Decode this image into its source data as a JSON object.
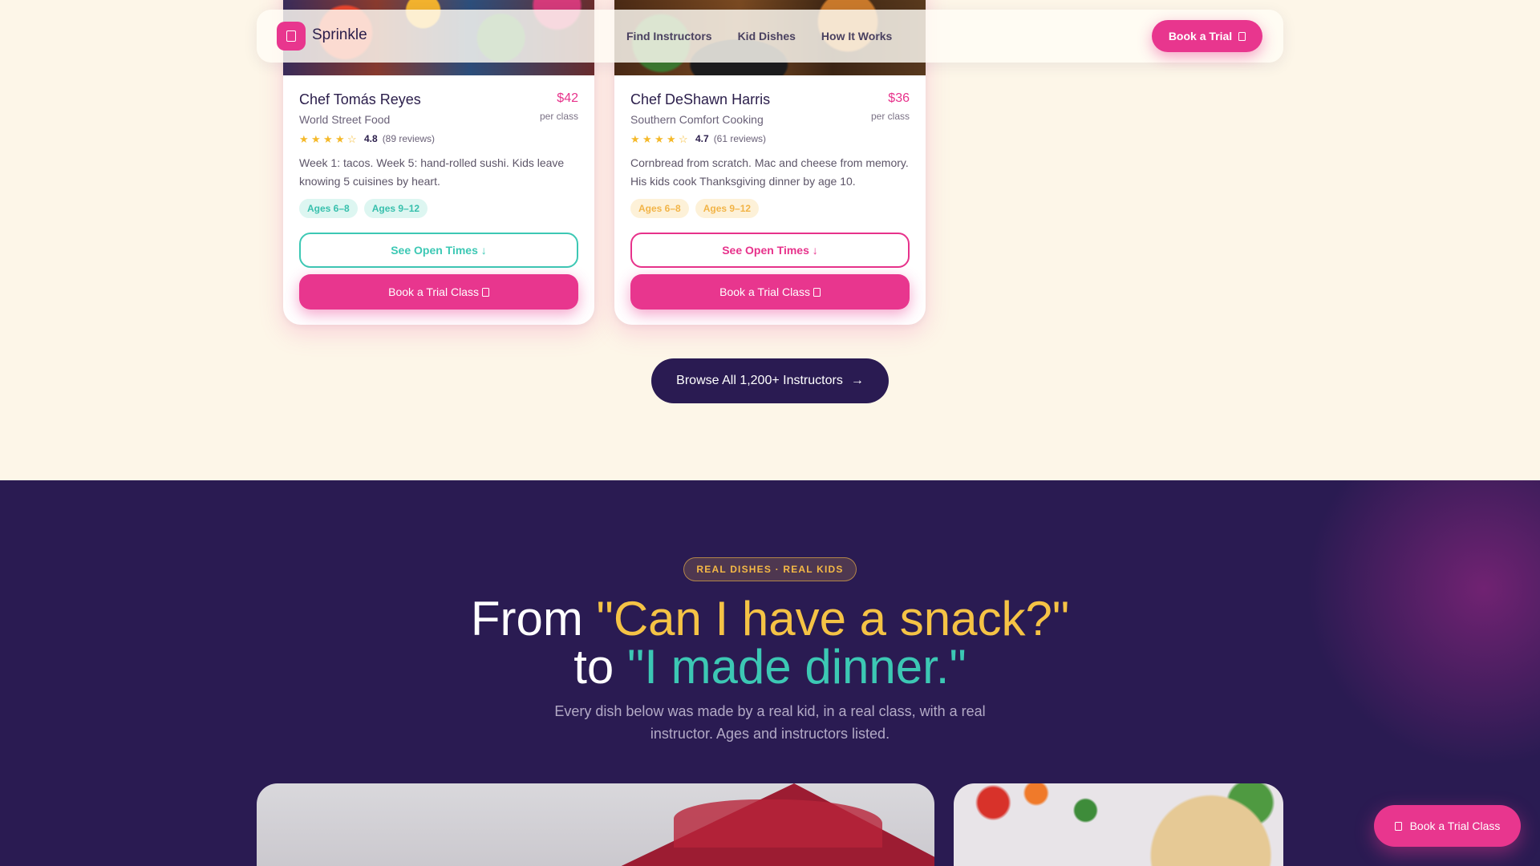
{
  "nav": {
    "brand": "Sprinkle",
    "links": [
      "Find Instructors",
      "Kid Dishes",
      "How It Works"
    ],
    "cta_label": "Book a Trial"
  },
  "instructors": [
    {
      "name": "Chef Tomás Reyes",
      "specialty": "World Street Food",
      "price": "$42",
      "price_unit": "per class",
      "rating": "4.8",
      "rating_stars": 4,
      "reviews": "(89 reviews)",
      "description": "Week 1: tacos. Week 5: hand-rolled sushi. Kids leave knowing 5 cuisines by heart.",
      "tags": [
        "Ages 6–8",
        "Ages 9–12"
      ],
      "times_label": "See Open Times ↓",
      "trial_label": "Book a Trial Class"
    },
    {
      "name": "Chef DeShawn Harris",
      "specialty": "Southern Comfort Cooking",
      "price": "$36",
      "price_unit": "per class",
      "rating": "4.7",
      "rating_stars": 4,
      "reviews": "(61 reviews)",
      "description": "Cornbread from scratch. Mac and cheese from memory. His kids cook Thanksgiving dinner by age 10.",
      "tags": [
        "Ages 6–8",
        "Ages 9–12"
      ],
      "times_label": "See Open Times ↓",
      "trial_label": "Book a Trial Class"
    }
  ],
  "browse_label": "Browse All 1,200+ Instructors",
  "dishes_section": {
    "eyebrow": "REAL DISHES · REAL KIDS",
    "headline_line1_pre": "From ",
    "headline_line1_quote": "\"Can I have a snack?\"",
    "headline_line2_pre": "to ",
    "headline_line2_quote": "\"I made dinner.\"",
    "subtext": "Every dish below was made by a real kid, in a real class, with a real instructor. Ages and instructors listed."
  },
  "floating_cta": "Book a Trial Class",
  "colors": {
    "accent_pink": "#e8368e",
    "teal": "#3cc8b4",
    "yellow": "#f5c345",
    "navy": "#2a1b52",
    "cream": "#fdf6e8"
  }
}
